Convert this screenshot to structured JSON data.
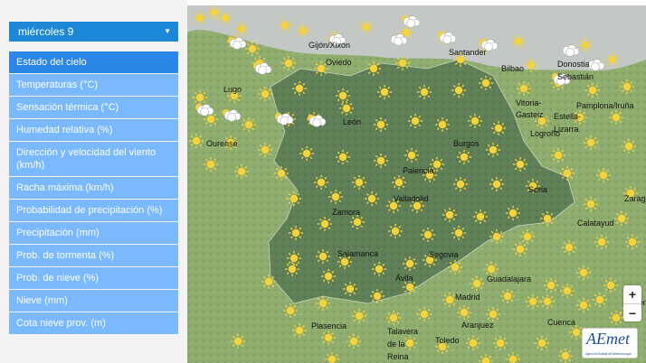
{
  "day_selector": {
    "label": "miércoles 9"
  },
  "menu": {
    "items": [
      {
        "label": "Estado del cielo",
        "active": true
      },
      {
        "label": "Temperaturas (°C)"
      },
      {
        "label": "Sensación térmica (°C)"
      },
      {
        "label": "Humedad relativa (%)"
      },
      {
        "label": "Dirección y velocidad del viento (km/h)"
      },
      {
        "label": "Racha máxima (km/h)"
      },
      {
        "label": "Probabilidad de precipitación (%)"
      },
      {
        "label": "Precipitación (mm)"
      },
      {
        "label": "Prob. de tormenta (%)"
      },
      {
        "label": "Prob. de nieve (%)"
      },
      {
        "label": "Nieve (mm)"
      },
      {
        "label": "Cota nieve prov. (m)"
      }
    ]
  },
  "map": {
    "places": [
      {
        "name": "Gijón/Xixón"
      },
      {
        "name": "Oviedo"
      },
      {
        "name": "Santander"
      },
      {
        "name": "Bilbao"
      },
      {
        "name": "Donostia"
      },
      {
        "name": "Sebastián"
      },
      {
        "name": "Lugo"
      },
      {
        "name": "Vitoria-"
      },
      {
        "name": "Gasteiz"
      },
      {
        "name": "Pamplona/Iruña"
      },
      {
        "name": "Estella-"
      },
      {
        "name": "Lizarra"
      },
      {
        "name": "León"
      },
      {
        "name": "Logroño"
      },
      {
        "name": "Ourense"
      },
      {
        "name": "Burgos"
      },
      {
        "name": "Palencia"
      },
      {
        "name": "Soria"
      },
      {
        "name": "Zarag"
      },
      {
        "name": "Valladolid"
      },
      {
        "name": "Zamora"
      },
      {
        "name": "Calatayud"
      },
      {
        "name": "Salamanca"
      },
      {
        "name": "Segovia"
      },
      {
        "name": "Ávila"
      },
      {
        "name": "Guadalajara"
      },
      {
        "name": "Madrid"
      },
      {
        "name": "Ter"
      },
      {
        "name": "Plasencia"
      },
      {
        "name": "Aranjuez"
      },
      {
        "name": "Cuenca"
      },
      {
        "name": "Talavera"
      },
      {
        "name": "de la"
      },
      {
        "name": "Reina"
      },
      {
        "name": "Toledo"
      }
    ],
    "icons": [
      "sun-icon",
      "sun-cloud-icon",
      "cloud-icon"
    ],
    "colors": {
      "sun": "#f6d23b",
      "cloud": "#ffffff",
      "region": "#5a7a55",
      "land": "#8fad6f"
    }
  },
  "zoom": {
    "in_label": "+",
    "out_label": "−"
  },
  "logo": {
    "text": "AEmet",
    "sub": "Agencia Estatal de Meteorología"
  }
}
